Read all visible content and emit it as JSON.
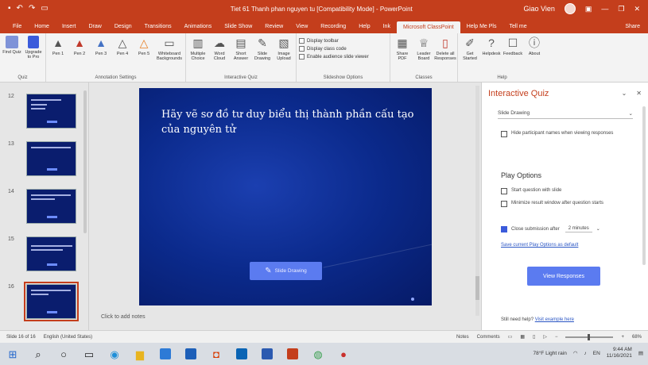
{
  "window": {
    "title": "Tiet 61 Thanh phan nguyen tu [Compatibility Mode] - PowerPoint",
    "user": "Giao Vien",
    "qat": [
      "save-icon",
      "undo-icon",
      "redo-icon",
      "present-icon"
    ],
    "controls": {
      "minimize": "—",
      "restore": "❐",
      "close": "✕"
    }
  },
  "tabs": [
    "File",
    "Home",
    "Insert",
    "Draw",
    "Design",
    "Transitions",
    "Animations",
    "Slide Show",
    "Review",
    "View",
    "Recording",
    "Help",
    "Tell Me",
    "Ink"
  ],
  "active_tab": "Microsoft ClassPoint",
  "tabs_after": [
    "Help Me Pls",
    "Tell me"
  ],
  "share_label": "Share",
  "ribbon": {
    "groups": [
      {
        "label": "Quiz",
        "buttons": [
          "Find Quiz",
          "Upgrade to Pro"
        ]
      },
      {
        "label": "Annotation Settings",
        "buttons": [
          "Pen 1",
          "Pen 2",
          "Pen 3",
          "Pen 4",
          "Pen 5",
          "Whiteboard Backgrounds"
        ]
      },
      {
        "label": "Interactive Quiz",
        "buttons": [
          "Multiple Choice",
          "Word Cloud",
          "Short Answer",
          "Slide Drawing",
          "Image Upload"
        ]
      },
      {
        "label": "Slideshow Options",
        "checks": [
          "Display toolbar",
          "Display class code",
          "Enable audience slide viewer"
        ]
      },
      {
        "label": "Classes",
        "buttons": [
          "Share PDF",
          "Leader Board",
          "Delete all Responses"
        ]
      },
      {
        "label": "Help",
        "buttons": [
          "Get Started",
          "Helpdesk",
          "Feedback",
          "About"
        ]
      }
    ]
  },
  "thumbnails": [
    {
      "num": "12",
      "selected": false
    },
    {
      "num": "13",
      "selected": false
    },
    {
      "num": "14",
      "selected": false
    },
    {
      "num": "15",
      "selected": false
    },
    {
      "num": "16",
      "selected": true
    }
  ],
  "slide": {
    "text": "Hãy vẽ sơ đồ tư duy biểu thị thành phần cấu tạo của nguyên tử",
    "button": "Slide Drawing",
    "notes_placeholder": "Click to add notes"
  },
  "pane": {
    "title": "Interactive Quiz",
    "dropdown_value": "Slide Drawing",
    "hide_names": "Hide participant names when viewing responses",
    "play_options_title": "Play Options",
    "start_with_slide": "Start question with slide",
    "minimize_window": "Minimize result window after question starts",
    "close_after": "Close submission after",
    "close_after_value": "2 minutes",
    "save_default_link": "Save current Play Options as default",
    "view_responses": "View Responses",
    "footer_text": "Still need help?",
    "footer_link": "Visit example here"
  },
  "status": {
    "slide_info": "Slide 16 of 16",
    "language": "English (United States)",
    "notes": "Notes",
    "comments": "Comments",
    "zoom": "68%"
  },
  "taskbar": {
    "weather": "78°F Light rain",
    "time": "9:44 AM",
    "date": "11/16/2021"
  }
}
